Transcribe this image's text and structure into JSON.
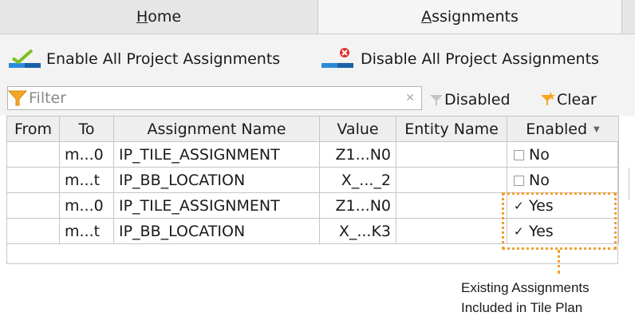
{
  "tabs": [
    {
      "label": "Home",
      "mnemonic": "H",
      "rest": "ome"
    },
    {
      "label": "Assignments",
      "mnemonic": "A",
      "rest": "ssignments"
    }
  ],
  "toolbar": {
    "enable_label": "Enable All Project Assignments",
    "disable_label": "Disable All Project Assignments"
  },
  "filter": {
    "placeholder": "Filter",
    "disabled_label": "Disabled",
    "clear_label": "Clear"
  },
  "table": {
    "columns": [
      "From",
      "To",
      "Assignment Name",
      "Value",
      "Entity Name",
      "Enabled"
    ],
    "rows": [
      {
        "from": "",
        "to": "m...0",
        "name": "IP_TILE_ASSIGNMENT",
        "value": "Z1...N0",
        "entity": "",
        "enabled": "No",
        "checked": false
      },
      {
        "from": "",
        "to": "m...t",
        "name": "IP_BB_LOCATION",
        "value": "X_..._2",
        "entity": "",
        "enabled": "No",
        "checked": false
      },
      {
        "from": "",
        "to": "m...0",
        "name": "IP_TILE_ASSIGNMENT",
        "value": "Z1...N0",
        "entity": "",
        "enabled": "Yes",
        "checked": true
      },
      {
        "from": "",
        "to": "m...t",
        "name": "IP_BB_LOCATION",
        "value": "X_...K3",
        "entity": "",
        "enabled": "Yes",
        "checked": true
      }
    ]
  },
  "annotation": {
    "line1": "Existing Assignments",
    "line2": "Included in Tile Plan",
    "color": "#f0a030"
  }
}
